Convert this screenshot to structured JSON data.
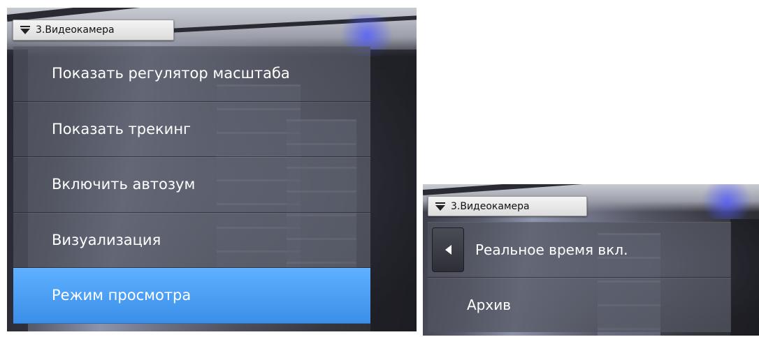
{
  "left_panel": {
    "camera_title": "3.Видеокамера",
    "menu_items": [
      {
        "label": "Показать регулятор масштаба"
      },
      {
        "label": "Показать трекинг"
      },
      {
        "label": "Включить автозум"
      },
      {
        "label": "Визуализация"
      },
      {
        "label": "Режим просмотра",
        "active": true
      }
    ]
  },
  "right_panel": {
    "camera_title": "3.Видеокамера",
    "submenu_items": [
      {
        "label": "Реальное время вкл."
      },
      {
        "label": "Архив"
      }
    ]
  },
  "icons": {
    "camera_menu": "chevron-down-icon",
    "back": "caret-left-icon"
  },
  "colors": {
    "active_item": "#3a8fe8",
    "menu_bg": "#525460",
    "text": "#ffffff"
  }
}
